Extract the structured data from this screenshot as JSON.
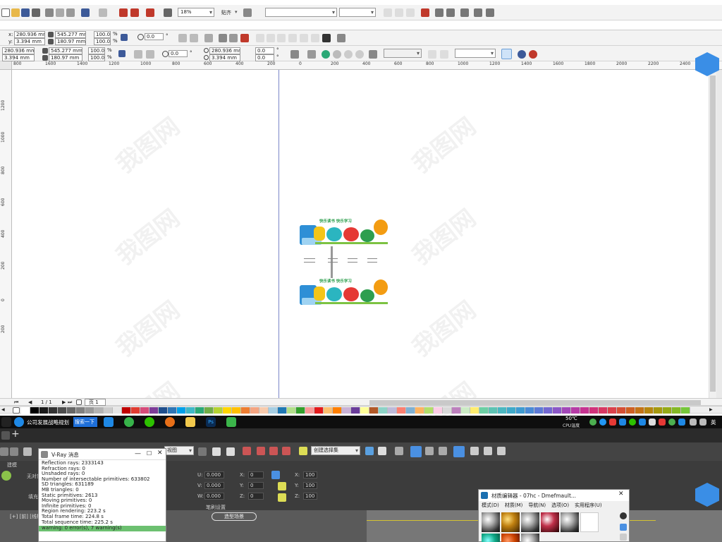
{
  "toolbar": {
    "zoom": "18%",
    "snap_label": "贴齐",
    "font_box": "",
    "size_box": ""
  },
  "props1": {
    "x": "280.936 mm",
    "y": "3.394 mm",
    "w": "545.277 mm",
    "h": "180.97 mm",
    "sx": "100.0",
    "sy": "100.0",
    "pct": "%",
    "angle": "0.0",
    "deg": "°"
  },
  "props2": {
    "x": "280.936 mm",
    "y": "3.394 mm",
    "w": "545.277 mm",
    "h": "180.97 mm",
    "sx": "100.0",
    "sy": "100.0",
    "angle": "0.0",
    "cx": "280.936 mm",
    "cy": "3.394 mm",
    "ox": "0.0",
    "oy": "0.0"
  },
  "ruler": {
    "h_ticks": [
      "800",
      "1600",
      "1400",
      "1200",
      "1000",
      "800",
      "600",
      "400",
      "200",
      "0",
      "200",
      "400",
      "600",
      "800",
      "1000",
      "1200",
      "1400",
      "1600",
      "1800",
      "2000",
      "2200",
      "2400"
    ],
    "v_ticks": [
      "1200",
      "1000",
      "800",
      "600",
      "400",
      "200",
      "0",
      "200"
    ]
  },
  "artwork": {
    "title_top": "快乐读书 快乐学习",
    "title_bottom": "快乐读书 快乐学习"
  },
  "watermark": "我图网",
  "page_nav": {
    "counter": "1 / 1",
    "tab": "页 1"
  },
  "taskbar": {
    "app1": "公司发展战略规划",
    "search": "搜索一下",
    "temp": "50℃",
    "cpu": "CPU温度",
    "lang": "英"
  },
  "max": {
    "view_combo": "视图",
    "selection_combo": "创建选择集",
    "tab1": "建模",
    "label_nosel": "无对象",
    "label_fill": "填充",
    "brush_settings": "笔刷设置",
    "vp_label": "[+] [前] [线框]",
    "u_label": "U:",
    "v_label": "V:",
    "w_label": "W:",
    "u_val": "0.000",
    "v_val": "0.000",
    "w_val": "0.000",
    "x_label": "X:",
    "y_label": "Y:",
    "z_label": "Z:",
    "x_val": "0",
    "y_val": "0",
    "z_val": "0",
    "x_pct": "100",
    "y_pct": "100",
    "z_pct": "100",
    "shape_label": "造型场景"
  },
  "vray": {
    "title": "V-Ray 消息",
    "lines": [
      "Reflection rays: 2333143",
      "Refraction rays: 0",
      "Unshaded rays: 0",
      "Number of intersectable primitives: 633802",
      "SD triangles: 631189",
      "MB triangles: 0",
      "Static primitives: 2613",
      "Moving primitives: 0",
      "Infinite primitives: 0",
      "Region rendering: 223.2 s",
      "Total frame time: 224.8 s",
      "Total sequence time: 225.2 s"
    ],
    "warning": "warning: 0 error(s), 7 warning(s)"
  },
  "mat_editor": {
    "title": "材质编辑器 - 07hc - Dmefmault...",
    "menus": [
      "模式(D)",
      "材质(M)",
      "导航(N)",
      "选项(O)",
      "实用程序(U)"
    ]
  },
  "colors": {
    "palette": [
      "#ffffff",
      "#000000",
      "#1a1a1a",
      "#333333",
      "#4d4d4d",
      "#666666",
      "#808080",
      "#999999",
      "#b3b3b3",
      "#cccccc",
      "#e6e6e6",
      "#c00000",
      "#e03c31",
      "#d64b7a",
      "#7d3c98",
      "#1f4e8c",
      "#2e75b6",
      "#00a0e9",
      "#3fb8c7",
      "#2aa876",
      "#70ad47",
      "#b5d334",
      "#ffd600",
      "#ffc000",
      "#ed7d31",
      "#f4a582",
      "#f8cbad",
      "#a6cee3",
      "#1f78b4",
      "#b2df8a",
      "#33a02c",
      "#fb9a99",
      "#e31a1c",
      "#fdbf6f",
      "#ff7f00",
      "#cab2d6",
      "#6a3d9a",
      "#ffff99",
      "#b15928",
      "#8dd3c7",
      "#bebada",
      "#fb8072",
      "#80b1d3",
      "#fdb462",
      "#b3de69",
      "#fccde5",
      "#d9d9d9",
      "#bc80bd",
      "#ccebc5",
      "#ffed6f",
      "#6ccfa4",
      "#5dc3b3",
      "#4bb7c0",
      "#3fa9c9",
      "#3f9bd1",
      "#4a8bd6",
      "#5d7ad6",
      "#7368d1",
      "#8b57c7",
      "#a247b8",
      "#b63ba6",
      "#c63391",
      "#d1327a",
      "#d83762",
      "#da414b",
      "#d64f35",
      "#cf6023",
      "#c47316",
      "#b6860f",
      "#a6990f",
      "#95aa17",
      "#84b926",
      "#75c73a"
    ]
  }
}
